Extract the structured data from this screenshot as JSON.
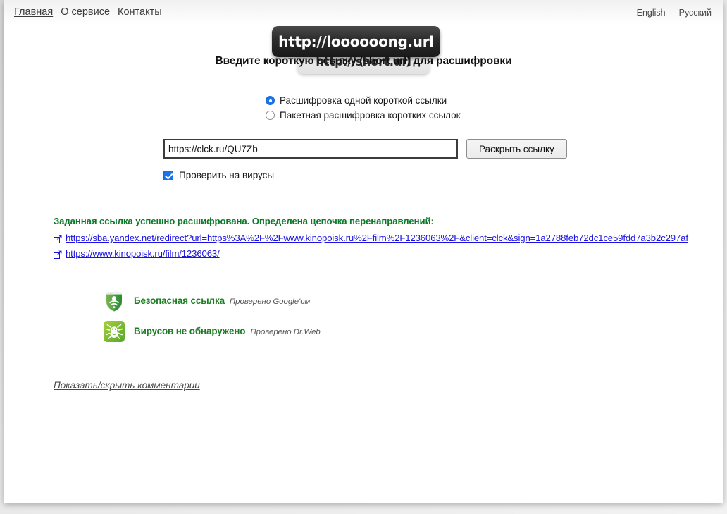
{
  "header": {
    "nav_left": [
      {
        "label": "Главная",
        "active": true
      },
      {
        "label": "О сервисе",
        "active": false
      },
      {
        "label": "Контакты",
        "active": false
      }
    ],
    "nav_right": [
      {
        "label": "English"
      },
      {
        "label": "Русский"
      }
    ]
  },
  "logo": {
    "long_url": "http://loooooong.url",
    "short_url": "http://short.url"
  },
  "main": {
    "headline": "Введите короткую ссылку (short url) для расшифровки",
    "radios": [
      {
        "label": "Расшифровка одной короткой ссылки",
        "checked": true
      },
      {
        "label": "Пакетная расшифровка коротких ссылок",
        "checked": false
      }
    ],
    "input": {
      "value": "https://clck.ru/QU7Zb",
      "placeholder": "https://clck.ru/QU7Zb"
    },
    "submit_label": "Раскрыть ссылку",
    "virus_check": {
      "label": "Проверить на вирусы",
      "checked": true
    }
  },
  "result": {
    "title": "Заданная ссылка успешно расшифрована. Определена цепочка перенаправлений:",
    "chain": [
      "https://sba.yandex.net/redirect?url=https%3A%2F%2Fwww.kinopoisk.ru%2Ffilm%2F1236063%2F&client=clck&sign=1a2788feb72dc1ce59fdd7a3b2c297af",
      "https://www.kinopoisk.ru/film/1236063/"
    ],
    "badges": [
      {
        "icon": "shield-safe-icon",
        "title": "Безопасная ссылка",
        "source": "Проверено Google'ом"
      },
      {
        "icon": "drweb-spider-icon",
        "title": "Вирусов не обнаружено",
        "source": "Проверено Dr.Web"
      }
    ]
  },
  "footer": {
    "comments_toggle": "Показать/скрыть комментарии"
  },
  "colors": {
    "accent_blue": "#1a73e8",
    "link_blue": "#1a12e0",
    "success_green": "#1a7d20",
    "result_green": "#0a7a28"
  }
}
